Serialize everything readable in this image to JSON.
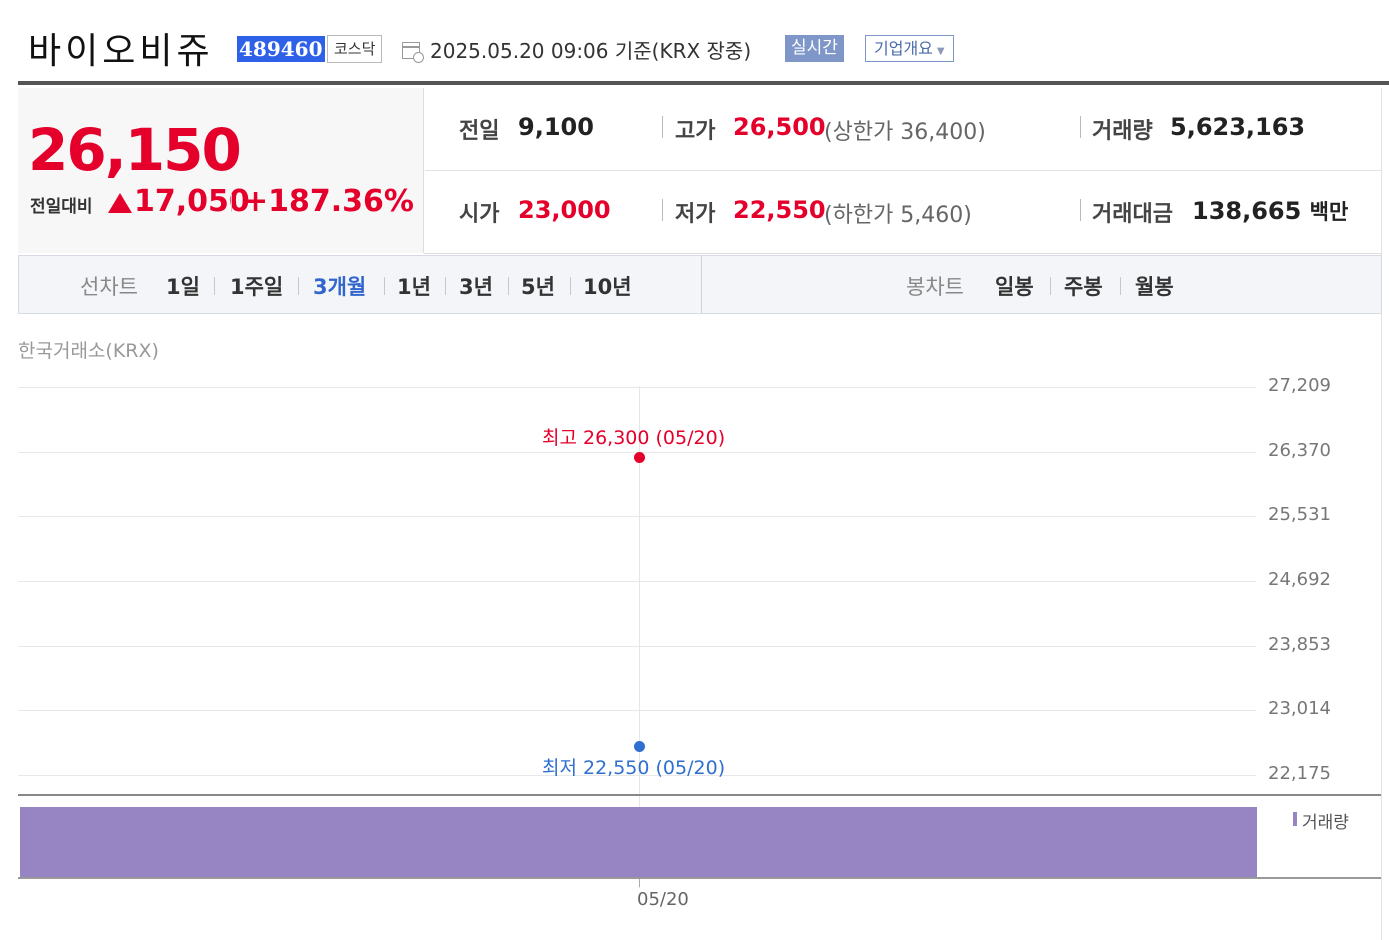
{
  "header": {
    "stock_name": "바이오비쥬",
    "stock_code": "489460",
    "market": "코스닥",
    "timestamp": "2025.05.20 09:06  기준(KRX 장중)",
    "realtime_label": "실시간",
    "company_overview_label": "기업개요",
    "company_overview_caret": "▼"
  },
  "price": {
    "current": "26,150",
    "compare_label": "전일대비",
    "change": "17,050",
    "change_pct": "+187.36%",
    "direction": "up"
  },
  "info": {
    "prev_label": "전일",
    "prev_value": "9,100",
    "open_label": "시가",
    "open_value": "23,000",
    "high_label": "고가",
    "high_value": "26,500",
    "upper_limit": "(상한가 36,400)",
    "low_label": "저가",
    "low_value": "22,550",
    "lower_limit": "(하한가 5,460)",
    "volume_label": "거래량",
    "volume_value": "5,623,163",
    "amount_label": "거래대금",
    "amount_value": "138,665",
    "amount_unit": "백만"
  },
  "tabs": {
    "line_chart_label": "선차트",
    "line_periods": [
      "1일",
      "1주일",
      "3개월",
      "1년",
      "3년",
      "5년",
      "10년"
    ],
    "selected_period": "3개월",
    "candle_chart_label": "봉차트",
    "candle_periods": [
      "일봉",
      "주봉",
      "월봉"
    ]
  },
  "chart_data": {
    "type": "line",
    "source_label": "한국거래소(KRX)",
    "y_ticks": [
      "27,209",
      "26,370",
      "25,531",
      "24,692",
      "23,853",
      "23,014",
      "22,175"
    ],
    "ylim": [
      22175,
      27209
    ],
    "x_ticks": [
      "05/20"
    ],
    "high_label": "최고 26,300 (05/20)",
    "high_value": 26300,
    "low_label": "최저 22,550 (05/20)",
    "low_value": 22550,
    "volume_label": "거래량",
    "colors": {
      "high": "#e4002b",
      "low": "#2f6fd0",
      "volume": "#9784c2"
    }
  },
  "colors": {
    "up": "#e4002b",
    "accent": "#2f61e8",
    "selected_tab": "#3366cc"
  }
}
